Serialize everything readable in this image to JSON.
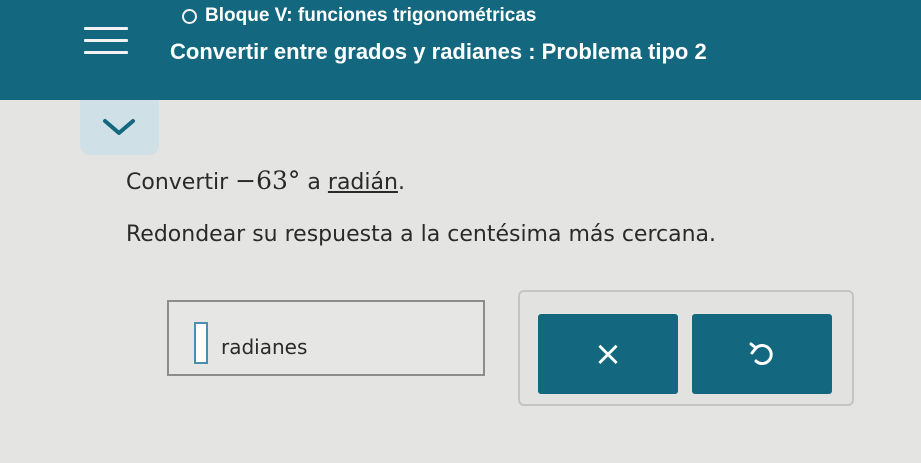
{
  "header": {
    "topic": "Bloque V: funciones trigonométricas",
    "title": "Convertir entre grados y radianes : Problema tipo 2"
  },
  "question": {
    "prefix": "Convertir",
    "value": "−63°",
    "connector": "a",
    "unit": "radián",
    "end": ".",
    "instruction": "Redondear su respuesta a la centésima más cercana."
  },
  "answer": {
    "unit_label": "radianes",
    "value": ""
  },
  "actions": {
    "clear_symbol": "×",
    "undo_icon": "undo-icon"
  },
  "colors": {
    "header": "#13677f",
    "button": "#13677f",
    "background": "#e4e4e2"
  }
}
